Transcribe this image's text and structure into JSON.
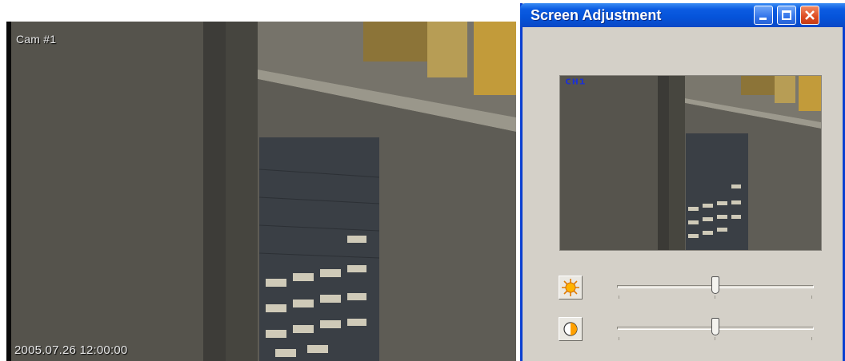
{
  "camera": {
    "label": "Cam #1",
    "timestamp": "2005.07.26 12:00:00"
  },
  "dialog": {
    "title": "Screen Adjustment",
    "preview_channel": "CH1",
    "brightness": {
      "icon": "sun-icon",
      "value": 0.5
    },
    "contrast": {
      "icon": "contrast-icon",
      "value": 0.5
    },
    "colors": {
      "titlebar": "#0553d9",
      "close": "#dd4b22",
      "face": "#d4d0c8"
    }
  }
}
